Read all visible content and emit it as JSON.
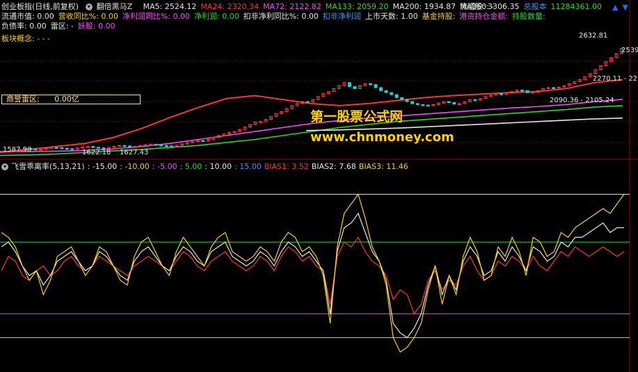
{
  "header": {
    "instrument": "创业板指(日线,前复权)",
    "indicator": "翻倍黑马Z",
    "ma": [
      {
        "label": "MA5: 2524.12",
        "color": "#e6e6e6"
      },
      {
        "label": "MA24: 2320.34",
        "color": "#ff3333"
      },
      {
        "label": "MA72: 2122.82",
        "color": "#ff44ff"
      },
      {
        "label": "MA133: 2059.20",
        "color": "#22dd22"
      },
      {
        "label": "MA200: 1934.87",
        "color": "#e6e6e6"
      },
      {
        "label": "MA360: -",
        "color": "#e6e6e6"
      }
    ],
    "right": [
      {
        "label": "流通股: 3306.35",
        "color": "#e6e6e6"
      },
      {
        "label": "总股本",
        "color": "#3399ff"
      },
      {
        "label": "11284361.00",
        "color": "#22dd22"
      }
    ]
  },
  "info_row1": [
    {
      "label": "流通市值: 0.00",
      "color": "#e6e6e6"
    },
    {
      "label": "营收同比%: 0.00",
      "color": "#ffd200"
    },
    {
      "label": "净利润同比%: 0.00",
      "color": "#ff44ff"
    },
    {
      "label": "净利润: 0.00",
      "color": "#22dd22"
    },
    {
      "label": "扣非净利同比%: 0.00",
      "color": "#e6e6e6"
    },
    {
      "label": "扣非净利润",
      "color": "#3399ff"
    },
    {
      "label": "上市天数: 1.00",
      "color": "#e6e6e6"
    },
    {
      "label": "基金持股:",
      "color": "#ffd200"
    },
    {
      "label": "港资持仓金额:",
      "color": "#ff44ff"
    },
    {
      "label": "持股数量:",
      "color": "#22dd22"
    }
  ],
  "info_row2": [
    {
      "label": "负债率: 0.00",
      "color": "#e6e6e6"
    },
    {
      "label": "雷区: -",
      "color": "#e6e6e6"
    },
    {
      "label": "妖股: 0.00",
      "color": "#ff44ff"
    }
  ],
  "sector": {
    "label": "板块概念: - - -"
  },
  "risk_box": {
    "label": "商誉雷区:",
    "value": "0.00亿"
  },
  "watermark": {
    "line1": "第一股票公式网",
    "line2": "www.chnmoney.com"
  },
  "bias_header": [
    {
      "label": "飞雪乖离率(5,13,21)",
      "color": "#e6e6e6"
    },
    {
      "label": ": -15.00",
      "color": "#e6e6e6"
    },
    {
      "label": ": -10.00",
      "color": "#ffd200"
    },
    {
      "label": ": -5.00",
      "color": "#ff44ff"
    },
    {
      "label": ": 5.00",
      "color": "#22dd22"
    },
    {
      "label": ": 10.00",
      "color": "#e6e6e6"
    },
    {
      "label": ": 15.00",
      "color": "#3399ff"
    },
    {
      "label": "BIAS1: 3.52",
      "color": "#ff3333"
    },
    {
      "label": "BIAS2: 7.68",
      "color": "#e6e6e6"
    },
    {
      "label": "BIAS3: 11.46",
      "color": "#ffd200"
    }
  ],
  "chart_data": [
    {
      "type": "line",
      "title": "创业板指(日线,前复权)",
      "ylim": [
        1550,
        2700
      ],
      "annotations": [
        {
          "text": "1587.90"
        },
        {
          "text": "1622.18"
        },
        {
          "text": "1627.43"
        },
        {
          "text": "2632.81"
        },
        {
          "text": "2539"
        },
        {
          "text": "2270.11 - 22"
        },
        {
          "text": "2090.36 - 2105.24"
        }
      ],
      "price": [
        1600,
        1605,
        1612,
        1620,
        1630,
        1625,
        1618,
        1622,
        1630,
        1640,
        1638,
        1632,
        1628,
        1624,
        1635,
        1645,
        1650,
        1642,
        1636,
        1630,
        1640,
        1652,
        1660,
        1655,
        1648,
        1650,
        1660,
        1668,
        1672,
        1665,
        1660,
        1655,
        1650,
        1662,
        1675,
        1690,
        1700,
        1710,
        1705,
        1720,
        1740,
        1760,
        1775,
        1790,
        1800,
        1820,
        1845,
        1870,
        1895,
        1900,
        1920,
        1950,
        1980,
        2000,
        2030,
        2060,
        2080,
        2100,
        2095,
        2120,
        2150,
        2180,
        2200,
        2230,
        2260,
        2290,
        2250,
        2230,
        2260,
        2280,
        2270,
        2240,
        2210,
        2190,
        2170,
        2140,
        2120,
        2100,
        2080,
        2070,
        2065,
        2060,
        2070,
        2085,
        2100,
        2090,
        2075,
        2080,
        2100,
        2120,
        2115,
        2130,
        2150,
        2165,
        2180,
        2170,
        2185,
        2200,
        2215,
        2210,
        2190,
        2195,
        2210,
        2230,
        2240,
        2235,
        2245,
        2260,
        2280,
        2300,
        2320,
        2350,
        2380,
        2420,
        2460,
        2500,
        2540,
        2580,
        2632
      ],
      "ma_lines": [
        {
          "name": "MA24",
          "color": "#ff3333",
          "values": [
            1590,
            1620,
            1650,
            1680,
            1740,
            1830,
            1940,
            2040,
            2130,
            2160,
            2120,
            2080,
            2060,
            2080,
            2110,
            2140,
            2160,
            2175,
            2190,
            2200,
            2230,
            2290,
            2320
          ]
        },
        {
          "name": "MA72",
          "color": "#ff44ff",
          "values": [
            1600,
            1600,
            1603,
            1610,
            1625,
            1650,
            1680,
            1720,
            1760,
            1800,
            1840,
            1880,
            1910,
            1935,
            1955,
            1975,
            1995,
            2015,
            2035,
            2050,
            2070,
            2100,
            2122
          ]
        },
        {
          "name": "MA133",
          "color": "#22dd22",
          "values": [
            1560,
            1565,
            1575,
            1590,
            1605,
            1620,
            1640,
            1660,
            1690,
            1720,
            1760,
            1800,
            1840,
            1870,
            1900,
            1920,
            1940,
            1960,
            1980,
            2000,
            2020,
            2045,
            2059
          ]
        },
        {
          "name": "MA200",
          "color": "#e6e6e6",
          "values": [
            1810,
            1815,
            1825,
            1835,
            1850,
            1865,
            1880,
            1895,
            1910,
            1925,
            1935
          ]
        }
      ]
    },
    {
      "type": "line",
      "title": "飞雪乖离率(5,13,21)",
      "ylim": [
        -20,
        20
      ],
      "levels": [
        {
          "value": -15,
          "color": "#ffd200"
        },
        {
          "value": -10,
          "color": "#ff44ff"
        },
        {
          "value": 5,
          "color": "#22dd22"
        },
        {
          "value": 15,
          "color": "#e6e6e6"
        }
      ],
      "series": [
        {
          "name": "BIAS1",
          "color": "#ff3333",
          "values": [
            -1,
            2,
            1,
            -2,
            -3,
            -1,
            0,
            -2,
            -1,
            1,
            2,
            0,
            -1,
            0,
            2,
            1,
            0,
            -1,
            -2,
            0,
            1,
            2,
            1,
            0,
            -1,
            1,
            3,
            2,
            0,
            -1,
            1,
            2,
            3,
            1,
            0,
            -1,
            0,
            2,
            1,
            -1,
            2,
            4,
            3,
            1,
            2,
            0,
            -1,
            -8,
            2,
            5,
            4,
            6,
            3,
            1,
            0,
            -2,
            -7,
            -5,
            -6,
            -10,
            -8,
            -3,
            -1,
            -5,
            -3,
            -4,
            0,
            2,
            -1,
            -3,
            -2,
            1,
            0,
            2,
            1,
            -1,
            2,
            0,
            -1,
            1,
            3,
            2,
            4,
            3,
            2,
            3,
            4,
            3,
            2,
            3
          ]
        },
        {
          "name": "BIAS2",
          "color": "#e6e6e6",
          "values": [
            4,
            5,
            3,
            0,
            -2,
            -1,
            -4,
            -2,
            1,
            2,
            3,
            1,
            -1,
            0,
            3,
            2,
            0,
            -2,
            -3,
            1,
            3,
            4,
            2,
            0,
            -1,
            2,
            4,
            3,
            1,
            0,
            3,
            4,
            5,
            2,
            1,
            0,
            1,
            3,
            2,
            0,
            3,
            5,
            4,
            2,
            3,
            1,
            -1,
            -10,
            3,
            8,
            9,
            11,
            7,
            3,
            1,
            -3,
            -12,
            -14,
            -15,
            -13,
            -10,
            -4,
            0,
            -6,
            -2,
            -5,
            1,
            4,
            2,
            -2,
            -1,
            3,
            1,
            4,
            2,
            -1,
            4,
            3,
            1,
            2,
            5,
            4,
            6,
            6,
            7,
            8,
            9,
            7,
            8,
            8
          ]
        },
        {
          "name": "BIAS3",
          "color": "#ffd200",
          "values": [
            7,
            6,
            4,
            0,
            -3,
            -1,
            -6,
            -3,
            2,
            3,
            4,
            1,
            -2,
            0,
            4,
            3,
            0,
            -3,
            -4,
            2,
            5,
            6,
            3,
            0,
            -2,
            3,
            6,
            4,
            2,
            0,
            4,
            6,
            7,
            3,
            2,
            1,
            2,
            4,
            3,
            1,
            5,
            7,
            6,
            3,
            4,
            2,
            -2,
            -12,
            4,
            11,
            13,
            15,
            10,
            4,
            1,
            -4,
            -15,
            -18,
            -17,
            -15,
            -12,
            -5,
            0,
            -8,
            -2,
            -6,
            2,
            6,
            3,
            -3,
            -2,
            4,
            2,
            6,
            3,
            -2,
            6,
            5,
            2,
            3,
            7,
            6,
            8,
            9,
            10,
            11,
            12,
            11,
            13,
            15
          ]
        }
      ]
    }
  ]
}
